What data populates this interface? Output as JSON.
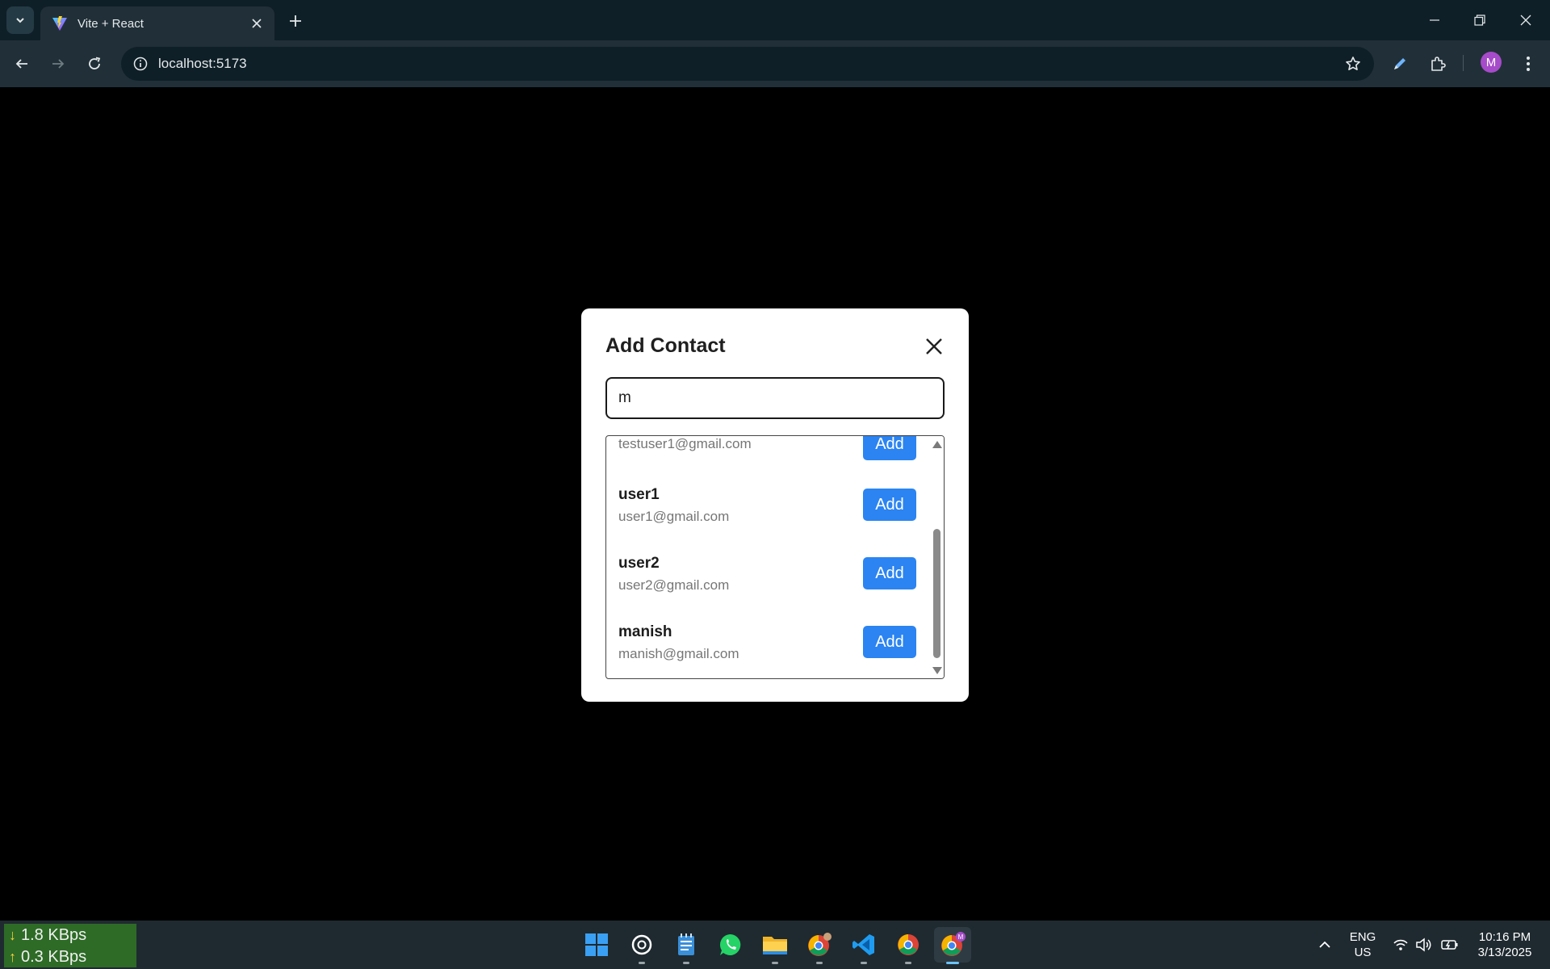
{
  "browser": {
    "tab_title": "Vite + React",
    "url": "localhost:5173",
    "profile_initial": "M"
  },
  "modal": {
    "title": "Add Contact",
    "search_value": "m",
    "results": [
      {
        "name": "",
        "email": "testuser1@gmail.com",
        "button": "Add"
      },
      {
        "name": "user1",
        "email": "user1@gmail.com",
        "button": "Add"
      },
      {
        "name": "user2",
        "email": "user2@gmail.com",
        "button": "Add"
      },
      {
        "name": "manish",
        "email": "manish@gmail.com",
        "button": "Add"
      }
    ]
  },
  "taskbar": {
    "download_speed": "1.8 KBps",
    "upload_speed": "0.3 KBps",
    "lang_top": "ENG",
    "lang_bottom": "US",
    "time": "10:16 PM",
    "date": "3/13/2025",
    "apps": [
      "windows-start",
      "chatgpt",
      "notepad",
      "whatsapp",
      "file-explorer",
      "chrome-profile",
      "vscode",
      "chrome",
      "chrome-active"
    ]
  },
  "colors": {
    "accent_button": "#2b84f1",
    "chrome_bg": "#0f1f27",
    "toolbar_bg": "#213038",
    "taskbar_bg": "#1f2a30",
    "netspeed_bg": "#2d6b26"
  }
}
